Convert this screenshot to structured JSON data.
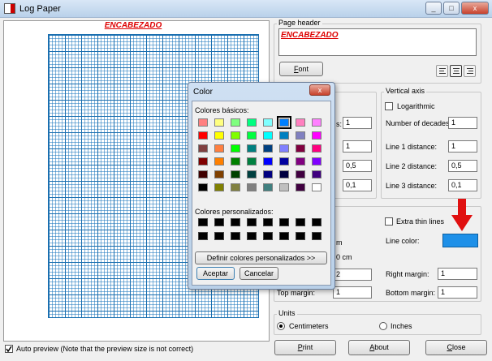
{
  "window": {
    "title": "Log Paper",
    "minimize": "_",
    "maximize": "□",
    "close": "x"
  },
  "preview": {
    "header_text": "ENCABEZADO"
  },
  "page_header": {
    "group_label": "Page header",
    "text": "ENCABEZADO",
    "font_button": "Font"
  },
  "vertical_axis": {
    "group_label": "Vertical axis",
    "logarithmic_label": "Logarithmic",
    "decades_label": "Number of decades:",
    "decades_value": "1",
    "line1_label": "Line 1 distance:",
    "line1_value": "1",
    "line2_label": "Line 2 distance:",
    "line2_value": "0,5",
    "line3_label": "Line 3 distance:",
    "line3_value": "0,1"
  },
  "horizontal_axis": {
    "decades_suffix": "s:",
    "decades_value": "1",
    "line1_value": "1",
    "line2_value": "0,5",
    "line3_value": "0,1"
  },
  "page_settings": {
    "extra_thin_label": "Extra thin lines",
    "line_color_label": "Line color:",
    "line_color": "#1e90e8",
    "partial_m": "m",
    "partial_cm": "0 cm",
    "left_margin_value": "2",
    "right_margin_label": "Right margin:",
    "right_margin_value": "1",
    "top_margin_label": "Top margin:",
    "top_margin_value": "1",
    "bottom_margin_label": "Bottom margin:",
    "bottom_margin_value": "1"
  },
  "units": {
    "group_label": "Units",
    "centimeters": "Centimeters",
    "inches": "Inches"
  },
  "footer": {
    "auto_preview": "Auto preview (Note that the preview size is not correct)",
    "print": "Print",
    "about": "About",
    "close": "Close"
  },
  "color_dialog": {
    "title": "Color",
    "close": "x",
    "basic_label": "Colores básicos:",
    "custom_label": "Colores personalizados:",
    "define_button": "Definir colores personalizados >>",
    "ok": "Aceptar",
    "cancel": "Cancelar",
    "basic_colors": [
      "#ff8080",
      "#ffff80",
      "#80ff80",
      "#00ff80",
      "#80ffff",
      "#0080ff",
      "#ff80c0",
      "#ff80ff",
      "#ff0000",
      "#ffff00",
      "#80ff00",
      "#00ff40",
      "#00ffff",
      "#0080c0",
      "#8080c0",
      "#ff00ff",
      "#804040",
      "#ff8040",
      "#00ff00",
      "#008080",
      "#004080",
      "#8080ff",
      "#800040",
      "#ff0080",
      "#800000",
      "#ff8000",
      "#008000",
      "#008040",
      "#0000ff",
      "#0000a0",
      "#800080",
      "#8000ff",
      "#400000",
      "#804000",
      "#004000",
      "#004040",
      "#000080",
      "#000040",
      "#400040",
      "#400080",
      "#000000",
      "#808000",
      "#808040",
      "#808080",
      "#408080",
      "#c0c0c0",
      "#400040",
      "#ffffff"
    ],
    "selected_index": 5
  },
  "icons": {
    "app": "log-paper-app-icon",
    "arrow": "red-down-arrow-icon"
  }
}
